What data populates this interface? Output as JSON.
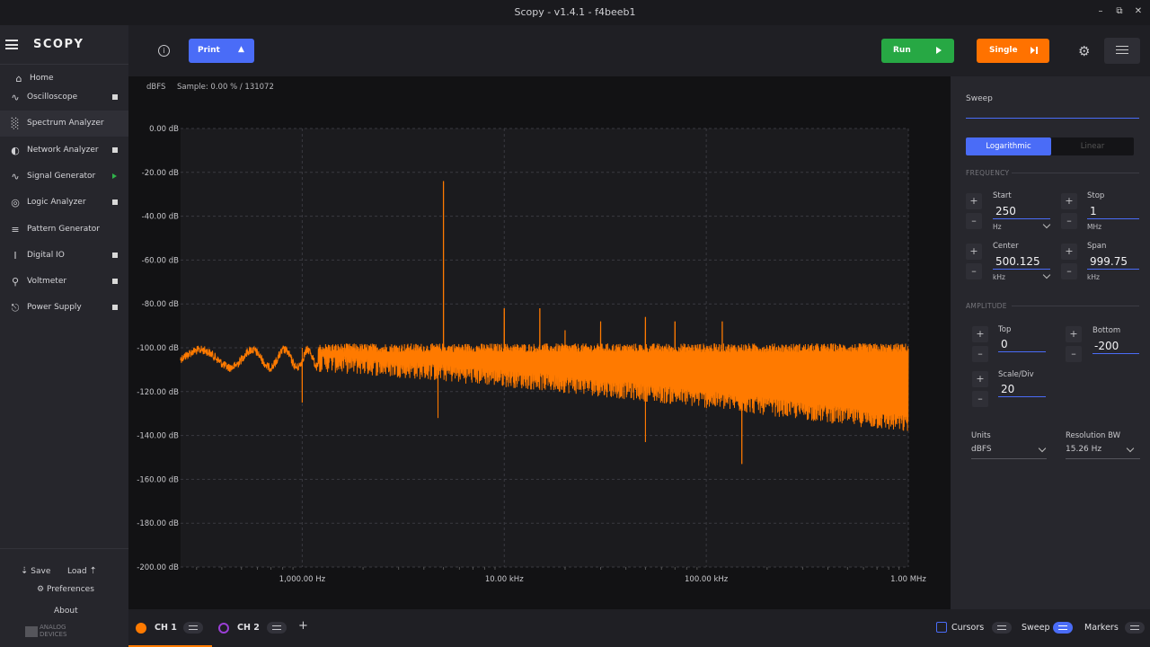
{
  "window": {
    "title": "Scopy - v1.4.1 - f4beeb1"
  },
  "sidebar": {
    "logo": "SCOPY",
    "home": "Home",
    "items": [
      {
        "label": "Oscilloscope",
        "icon": "oscilloscope-icon",
        "status": "stopped"
      },
      {
        "label": "Spectrum Analyzer",
        "icon": "spectrum-analyzer-icon",
        "status": "none",
        "active": true
      },
      {
        "label": "Network Analyzer",
        "icon": "network-analyzer-icon",
        "status": "stopped"
      },
      {
        "label": "Signal Generator",
        "icon": "signal-generator-icon",
        "status": "running"
      },
      {
        "label": "Logic Analyzer",
        "icon": "logic-analyzer-icon",
        "status": "stopped"
      },
      {
        "label": "Pattern Generator",
        "icon": "pattern-generator-icon",
        "status": "none"
      },
      {
        "label": "Digital IO",
        "icon": "digital-io-icon",
        "status": "stopped"
      },
      {
        "label": "Voltmeter",
        "icon": "voltmeter-icon",
        "status": "stopped"
      },
      {
        "label": "Power Supply",
        "icon": "power-supply-icon",
        "status": "stopped"
      }
    ],
    "save": "Save",
    "load": "Load",
    "preferences": "Preferences",
    "about": "About",
    "vendor_line1": "ANALOG",
    "vendor_line2": "DEVICES"
  },
  "toolbar": {
    "print_label": "Print",
    "run_label": "Run",
    "single_label": "Single",
    "run_color": "#27a844",
    "single_color": "#ff7200",
    "print_color": "#4a6cf7"
  },
  "plot": {
    "unit_label": "dBFS",
    "sample_label": "Sample: 0.00 % / 131072",
    "trace_color": "#ff7a00"
  },
  "chart_data": {
    "type": "line",
    "title": "",
    "xlabel": "",
    "ylabel": "",
    "x_scale": "log",
    "xlim": [
      250,
      1000000
    ],
    "ylim": [
      -200,
      0
    ],
    "y_ticks": [
      "0.00 dB",
      "-20.00 dB",
      "-40.00 dB",
      "-60.00 dB",
      "-80.00 dB",
      "-100.00 dB",
      "-120.00 dB",
      "-140.00 dB",
      "-160.00 dB",
      "-180.00 dB",
      "-200.00 dB"
    ],
    "x_ticks": [
      {
        "value": 1000,
        "label": "1,000.00 Hz"
      },
      {
        "value": 10000,
        "label": "10.00 kHz"
      },
      {
        "value": 100000,
        "label": "100.00 kHz"
      },
      {
        "value": 1000000,
        "label": "1.00 MHz"
      }
    ],
    "grid": true,
    "series": [
      {
        "noise_floor_db": -100,
        "noise_band_low_db_at_start": -104,
        "noise_band_low_db_at_end": -135,
        "spikes": [
          {
            "freq": 5000,
            "db": -24
          },
          {
            "freq": 10000,
            "db": -82
          },
          {
            "freq": 15000,
            "db": -82
          },
          {
            "freq": 20000,
            "db": -92
          },
          {
            "freq": 30000,
            "db": -88
          },
          {
            "freq": 50000,
            "db": -86
          },
          {
            "freq": 70000,
            "db": -88
          },
          {
            "freq": 120000,
            "db": -88
          }
        ],
        "dips": [
          {
            "freq": 1000,
            "db": -125
          },
          {
            "freq": 4700,
            "db": -132
          },
          {
            "freq": 50000,
            "db": -143
          },
          {
            "freq": 150000,
            "db": -153
          }
        ]
      }
    ]
  },
  "panel": {
    "title": "Sweep",
    "scale_options": [
      "Logarithmic",
      "Linear"
    ],
    "scale_selected": "Logarithmic",
    "frequency_section": "FREQUENCY",
    "start": {
      "label": "Start",
      "value": "250",
      "unit": "Hz"
    },
    "stop": {
      "label": "Stop",
      "value": "1",
      "unit": "MHz"
    },
    "center": {
      "label": "Center",
      "value": "500.125",
      "unit": "kHz"
    },
    "span": {
      "label": "Span",
      "value": "999.75",
      "unit": "kHz"
    },
    "amplitude_section": "AMPLITUDE",
    "top": {
      "label": "Top",
      "value": "0"
    },
    "bottom": {
      "label": "Bottom",
      "value": "-200"
    },
    "scale_div": {
      "label": "Scale/Div",
      "value": "20"
    },
    "units": {
      "label": "Units",
      "value": "dBFS"
    },
    "rbw": {
      "label": "Resolution BW",
      "value": "15.26 Hz"
    }
  },
  "bottom": {
    "ch1": "CH 1",
    "ch2": "CH 2",
    "ch1_color": "#ff7a00",
    "ch2_color": "#9b3fd6",
    "cursors": "Cursors",
    "sweep": "Sweep",
    "markers": "Markers"
  }
}
